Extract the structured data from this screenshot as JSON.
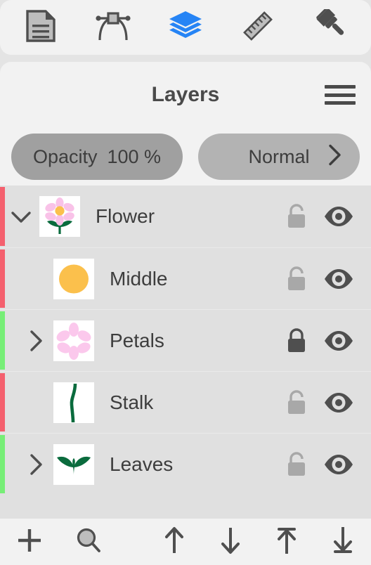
{
  "toolbar_top": {
    "items": [
      {
        "name": "document-icon",
        "label": "Document",
        "active": false
      },
      {
        "name": "node-edit-icon",
        "label": "Node Edit",
        "active": false
      },
      {
        "name": "layers-icon",
        "label": "Layers",
        "active": true
      },
      {
        "name": "ruler-icon",
        "label": "Ruler",
        "active": false
      },
      {
        "name": "brush-icon",
        "label": "Brush",
        "active": false
      }
    ],
    "active_color": "#2684f5",
    "inactive_color": "#4f4f4f"
  },
  "panel": {
    "title": "Layers",
    "menu_label": "Menu"
  },
  "controls": {
    "opacity_label": "Opacity",
    "opacity_value": "100 %",
    "blend_mode": "Normal",
    "opacity_pill_color": "#a0a0a0",
    "blend_pill_color": "#b3b3b3"
  },
  "layers": [
    {
      "name": "Flower",
      "indent": 0,
      "disclosure": "chevron-down",
      "marker_color": "#f4606e",
      "locked": false,
      "visible": true,
      "thumb": "flower"
    },
    {
      "name": "Middle",
      "indent": 1,
      "disclosure": "none",
      "marker_color": "#f4606e",
      "locked": false,
      "visible": true,
      "thumb": "circle"
    },
    {
      "name": "Petals",
      "indent": 1,
      "disclosure": "chevron-right",
      "marker_color": "#77ee77",
      "locked": true,
      "visible": true,
      "thumb": "petals"
    },
    {
      "name": "Stalk",
      "indent": 1,
      "disclosure": "none",
      "marker_color": "#f4606e",
      "locked": false,
      "visible": true,
      "thumb": "stalk"
    },
    {
      "name": "Leaves",
      "indent": 1,
      "disclosure": "chevron-right",
      "marker_color": "#77ee77",
      "locked": false,
      "visible": true,
      "thumb": "leaves"
    }
  ],
  "toolbar_bottom": {
    "items": [
      {
        "name": "add-layer-button",
        "label": "Add"
      },
      {
        "name": "search-layer-button",
        "label": "Search"
      },
      {
        "name": "move-layer-up-button",
        "label": "Move Up"
      },
      {
        "name": "move-layer-down-button",
        "label": "Move Down"
      },
      {
        "name": "move-layer-top-button",
        "label": "Move To Top"
      },
      {
        "name": "move-layer-bottom-button",
        "label": "Move To Bottom"
      }
    ]
  },
  "colors": {
    "panel_bg": "#f2f2f2",
    "list_bg": "#e0e0e0",
    "window_bg": "#e4e4e4",
    "text": "#3d3d3d",
    "icon": "#4f4f4f",
    "lock_open": "#a8a8a8",
    "lock_closed": "#4f4f4f",
    "thumb_bg": "#ffffff",
    "petal_pink": "#f9c2e8",
    "petal_pink_light": "#fbc8ec",
    "center_yellow": "#fbc04c",
    "leaf_green": "#0a6b3d"
  }
}
